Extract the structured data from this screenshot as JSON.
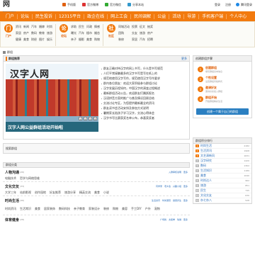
{
  "site": {
    "logo": "汉字人网",
    "logo_sub": "hanzi.renwang.cn"
  },
  "toplinks": [
    {
      "label": "手机版",
      "icon": "phone-icon",
      "color": "#e06010"
    },
    {
      "label": "官方微博",
      "icon": "weibo-icon",
      "color": "#d33"
    },
    {
      "label": "官方微信",
      "icon": "wechat-icon",
      "color": "#3a3"
    },
    {
      "label": "分享本站",
      "icon": "share-icon",
      "color": "#39c"
    }
  ],
  "user": {
    "login": "登录",
    "register": "注册",
    "qq": "腾讯登录"
  },
  "nav": [
    "门户",
    "论坛",
    "民生投诉",
    "12315平台",
    "政企在线",
    "网上工会",
    "民间调解",
    "公益",
    "活动",
    "导游",
    "手机客户端",
    "个人中心"
  ],
  "subnav": [
    {
      "badge": "门",
      "caption": "门户",
      "links": [
        "资讯",
        "新闻",
        "汽车",
        "婚嫁",
        "时尚",
        "家居",
        "房产",
        "数码",
        "教育",
        "旅游",
        "健康",
        "美食",
        "财经",
        "图片",
        "娱乐"
      ]
    },
    {
      "badge": "论",
      "caption": "论坛",
      "links": [
        "求助",
        "民生",
        "问政",
        "情感",
        "曝光",
        "汽车",
        "楼市",
        "婚恋",
        "亲子",
        "摄影",
        "美食",
        "购物"
      ]
    },
    {
      "badge": "社",
      "caption": "社区",
      "links": [
        "同城活动",
        "投票",
        "征文",
        "抽奖",
        "团购",
        "交友",
        "旅游",
        "房产",
        "装修",
        "家居",
        "汽车",
        "招聘"
      ]
    }
  ],
  "breadcrumb": {
    "home": "首页",
    "current": "群组"
  },
  "featured": {
    "header": "群组推荐",
    "more": "更多",
    "image_title": "汉字人网",
    "caption": "汉字人网公益群组活动开始啦",
    "dots": [
      "1",
      "2",
      "3",
      "4"
    ],
    "news": [
      "群友正确对待汉字的网上书写，什么是书写规范",
      "人们平常接触最多的汉字书写是写在纸上的",
      "规范地使用汉字写作，规范使用汉字写作要求",
      "群内各位朋友：欢迎大家积极参与群组讨论",
      "汉字发展历程如何，中国汉字的演变过程概述",
      "最新群组活动公告，欢迎群友们踊跃报名",
      "汉语拼音方案的推广与普及情况回顾总结",
      "交流讨论专区，为您提供最新最全的资讯",
      "群友读书会活动安排及参加方式说明",
      "暑期家长陪孩子学习汉字，交流心得体会",
      "汉字书写比赛获奖名单公布，恭喜获奖者"
    ]
  },
  "search": {
    "label": "搜索群组"
  },
  "groups_header": "群组分类",
  "groups": [
    {
      "name": "人物沟通",
      "count": "(26)",
      "links": [
        "入群审核说明",
        "更多"
      ],
      "items": [
        "电脑技术",
        "哲学与网络思维"
      ]
    },
    {
      "name": "文化交友",
      "count": "(33)",
      "links": [
        "同学录",
        "老乡会",
        "兴趣小组",
        "更多"
      ],
      "items": [
        "大学三年",
        "站前影视",
        "创作园地",
        "好友推荐",
        "旅游分享",
        "精英交流",
        "美食",
        "小说"
      ]
    },
    {
      "name": "时尚生活",
      "count": "(46)",
      "links": [
        "生活资讯",
        "时尚潮流",
        "健康养生",
        "更多"
      ],
      "items": [
        "时尚资讯",
        "生活常识",
        "美食",
        "居家装饰",
        "数码科技",
        "亲子教育",
        "家装设计",
        "装修",
        "购物",
        "美容",
        "手工DIY",
        "户外",
        "宠物"
      ]
    },
    {
      "name": "体育健身",
      "count": "(28)",
      "links": [
        "广场舞",
        "太极拳",
        "瑜伽",
        "更多"
      ],
      "items": []
    }
  ],
  "create": {
    "header": "创建群组步骤",
    "steps": [
      {
        "n": "1",
        "title": "创建群组",
        "desc": "填写群组基本信息"
      },
      {
        "n": "2",
        "title": "个性设置",
        "desc": "设置群组风格样式"
      },
      {
        "n": "3",
        "title": "邀请好友",
        "desc": "邀请好友加入群组"
      },
      {
        "n": "4",
        "title": "群组开始",
        "desc": "开始群组精彩生活"
      }
    ],
    "button": "创建一个属于自己的群组"
  },
  "ranking": {
    "header": "群组积分排行",
    "rows": [
      {
        "name": "时尚生活",
        "value": "2182"
      },
      {
        "name": "生活资讯",
        "value": "1908"
      },
      {
        "name": "文艺清新风",
        "value": "1631"
      },
      {
        "name": "汉字研究",
        "value": "1420"
      },
      {
        "name": "数码",
        "value": "1302"
      },
      {
        "name": "生活知识",
        "value": "1189"
      },
      {
        "name": "美食",
        "value": "1040"
      },
      {
        "name": "时尚达人",
        "value": "962"
      },
      {
        "name": "旅游",
        "value": "851"
      },
      {
        "name": "民生",
        "value": "745"
      },
      {
        "name": "文化交友",
        "value": "630"
      },
      {
        "name": "杂七杂八",
        "value": "528"
      }
    ]
  }
}
